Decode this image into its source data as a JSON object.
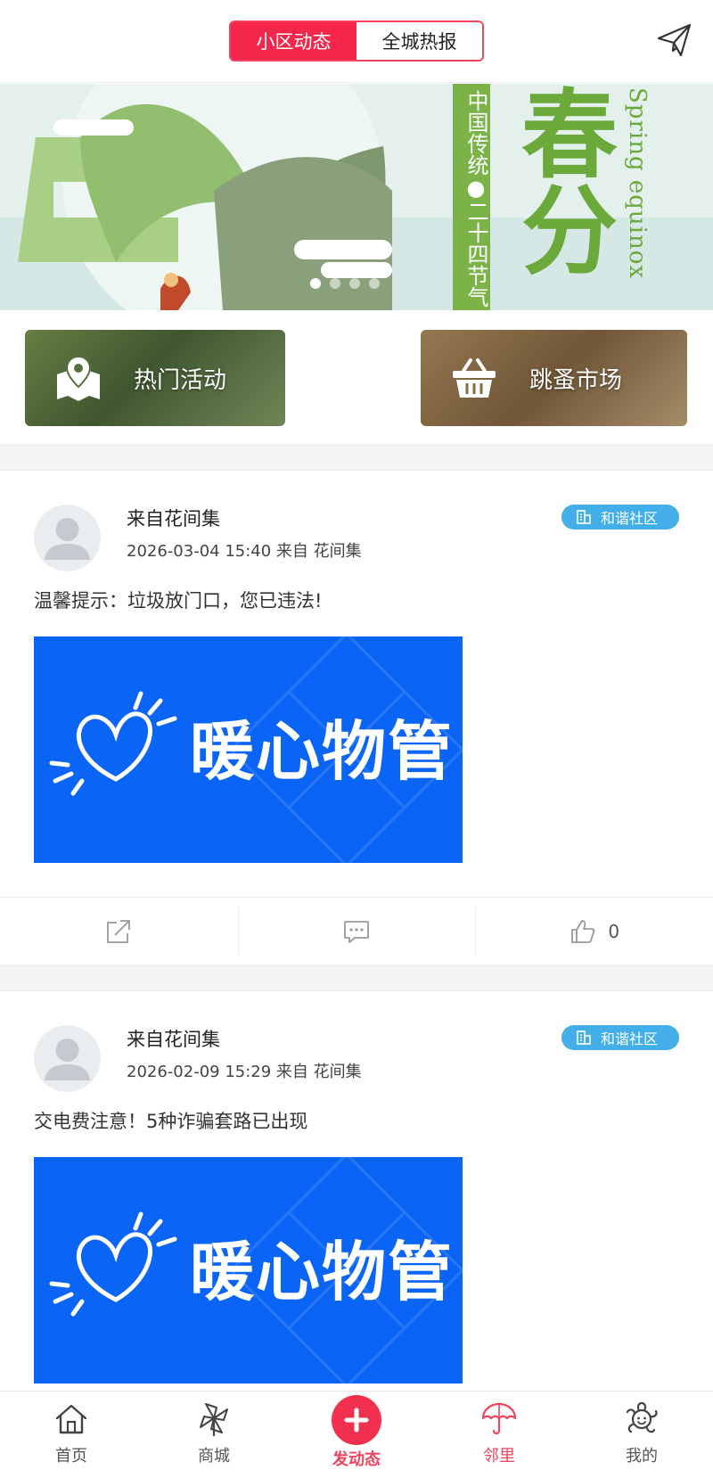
{
  "header": {
    "tabs": [
      {
        "label": "小区动态",
        "active": true
      },
      {
        "label": "全城热报",
        "active": false
      }
    ],
    "send_icon": "paper-plane-icon"
  },
  "banner": {
    "vertical_text": "中国传统●二十四节气",
    "big_text": "春分",
    "english_text": "Spring equinox",
    "dots": 4,
    "active_dot": 0
  },
  "quick_tiles": [
    {
      "label": "热门活动",
      "icon": "map-pin-icon"
    },
    {
      "label": "跳蚤市场",
      "icon": "basket-icon"
    }
  ],
  "posts": [
    {
      "author": "来自花间集",
      "meta": "2026-03-04 15:40 来自 花间集",
      "badge": "和谐社区",
      "text": "温馨提示：垃圾放门口，您已违法!",
      "image_text": "暖心物管",
      "likes": "0"
    },
    {
      "author": "来自花间集",
      "meta": "2026-02-09 15:29 来自 花间集",
      "badge": "和谐社区",
      "text": "交电费注意！5种诈骗套路已出现",
      "image_text": "暖心物管"
    }
  ],
  "tabbar": {
    "items": [
      {
        "label": "首页",
        "icon": "home-icon"
      },
      {
        "label": "商城",
        "icon": "pinwheel-icon"
      },
      {
        "label": "发动态",
        "icon": "plus-icon"
      },
      {
        "label": "邻里",
        "icon": "umbrella-icon",
        "active": true
      },
      {
        "label": "我的",
        "icon": "flower-icon"
      }
    ]
  },
  "colors": {
    "accent": "#f5264a",
    "badge": "#43aee8",
    "image_bg": "#0a64f5"
  }
}
